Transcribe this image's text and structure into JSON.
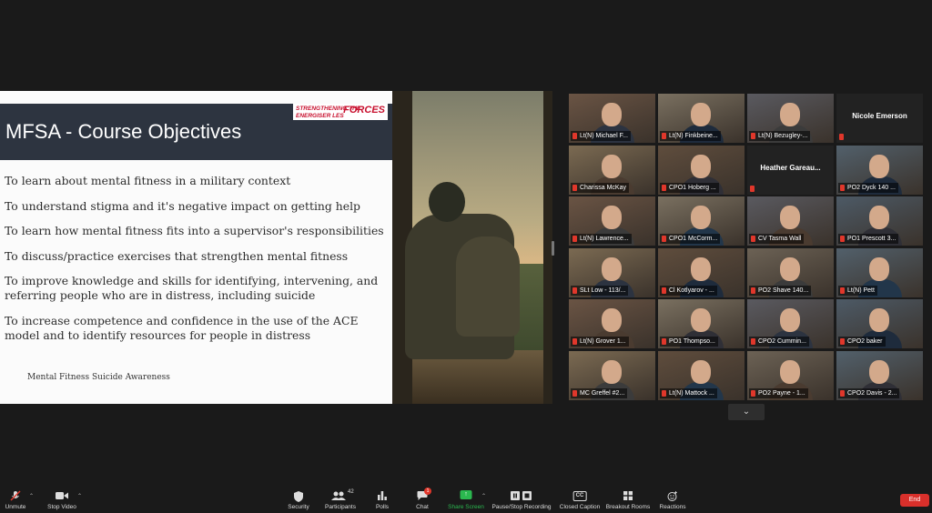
{
  "slide": {
    "title": "MFSA - Course Objectives",
    "logo_line1": "STRENGTHENING THE",
    "logo_line2": "ENERGISER LES",
    "logo_big": "FORCES",
    "objectives": [
      "To learn about mental fitness in a military context",
      "To understand stigma and it's negative impact on getting help",
      "To learn how mental fitness fits into a supervisor's responsibilities",
      "To discuss/practice exercises that strengthen mental fitness",
      "To improve knowledge and skills for identifying, intervening, and referring people who are in distress, including suicide",
      "To increase competence and confidence in the use of the ACE model and to identify resources for people in distress"
    ],
    "footer": "Mental Fitness Suicide Awareness"
  },
  "gallery": {
    "tiles": [
      {
        "name": "Lt(N) Michael F...",
        "video": true
      },
      {
        "name": "Lt(N) Finkbeine...",
        "video": true
      },
      {
        "name": "Lt(N) Bezugley-...",
        "video": true
      },
      {
        "name": "Nicole Emerson",
        "video": false
      },
      {
        "name": "Charissa McKay",
        "video": true,
        "active": true
      },
      {
        "name": "CPO1 Hoberg ...",
        "video": true
      },
      {
        "name": "Heather  Gareau...",
        "video": false
      },
      {
        "name": "PO2 Dyck 140 ...",
        "video": true
      },
      {
        "name": "Lt(N) Lawrence...",
        "video": true
      },
      {
        "name": "CPO1 McCorm...",
        "video": true
      },
      {
        "name": "CV Tasma Wall",
        "video": true
      },
      {
        "name": "PO1 Prescott 3...",
        "video": true
      },
      {
        "name": "SLt Low - 113/...",
        "video": true
      },
      {
        "name": "Cl Kotlyarov - ...",
        "video": true
      },
      {
        "name": "PO2 Shave 140...",
        "video": true
      },
      {
        "name": "Lt(N) Pett",
        "video": true
      },
      {
        "name": "Lt(N) Grover 1...",
        "video": true
      },
      {
        "name": "PO1 Thompso...",
        "video": true
      },
      {
        "name": "CPO2 Cummin...",
        "video": true
      },
      {
        "name": "CPO2 baker",
        "video": true
      },
      {
        "name": "MC Greffel #2...",
        "video": true
      },
      {
        "name": "Lt(N) Mattock ...",
        "video": true
      },
      {
        "name": "PO2 Payne - 1...",
        "video": true
      },
      {
        "name": "CPO2 Davis - 2...",
        "video": true
      }
    ],
    "more_icon": "chevron-down-icon"
  },
  "toolbar": {
    "unmute": "Unmute",
    "stop_video": "Stop Video",
    "security": "Security",
    "participants": "Participants",
    "participants_count": "42",
    "polls": "Polls",
    "chat": "Chat",
    "chat_badge": "1",
    "share_screen": "Share Screen",
    "pause_recording": "Pause/Stop Recording",
    "closed_caption": "Closed Caption",
    "closed_caption_icon": "CC",
    "breakout_rooms": "Breakout Rooms",
    "reactions": "Reactions",
    "end": "End"
  },
  "colors": {
    "share_green": "#2bb84f",
    "end_red": "#d9302b",
    "active_speaker": "#c7e06a",
    "slide_header": "#2d3440"
  }
}
